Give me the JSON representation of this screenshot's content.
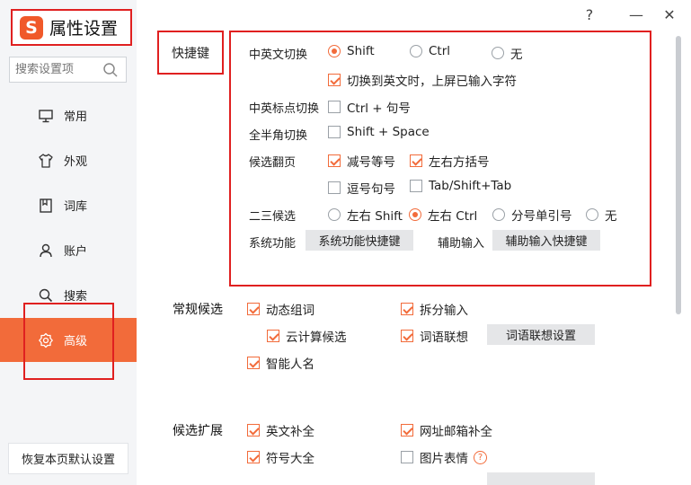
{
  "app": {
    "logo_letter": "S",
    "title": "属性设置"
  },
  "window": {
    "help": "?",
    "minimize": "—",
    "close": "✕"
  },
  "search": {
    "placeholder": "搜索设置项"
  },
  "nav": [
    {
      "label": "常用",
      "icon": "monitor-icon"
    },
    {
      "label": "外观",
      "icon": "shirt-icon"
    },
    {
      "label": "词库",
      "icon": "book-icon"
    },
    {
      "label": "账户",
      "icon": "user-icon"
    },
    {
      "label": "搜索",
      "icon": "search-icon"
    },
    {
      "label": "高级",
      "icon": "gear-icon",
      "active": true
    }
  ],
  "reset_label": "恢复本页默认设置",
  "shortcuts": {
    "section": "快捷键",
    "cn_en": {
      "label": "中英文切换",
      "options": [
        "Shift",
        "Ctrl",
        "无"
      ],
      "selected": "Shift"
    },
    "commit_on_switch": {
      "label": "切换到英文时，上屏已输入字符",
      "checked": true
    },
    "punct": {
      "label": "中英标点切换",
      "option": "Ctrl + 句号",
      "checked": false
    },
    "width": {
      "label": "全半角切换",
      "option": "Shift + Space",
      "checked": false
    },
    "paging": {
      "label": "候选翻页",
      "options": [
        {
          "text": "减号等号",
          "checked": true
        },
        {
          "text": "左右方括号",
          "checked": true
        },
        {
          "text": "逗号句号",
          "checked": false
        },
        {
          "text": "Tab/Shift+Tab",
          "checked": false
        }
      ]
    },
    "second_third": {
      "label": "二三候选",
      "options": [
        "左右 Shift",
        "左右 Ctrl",
        "分号单引号",
        "无"
      ],
      "selected": "左右 Ctrl"
    },
    "system": {
      "label": "系统功能",
      "button": "系统功能快捷键"
    },
    "assist": {
      "label": "辅助输入",
      "button": "辅助输入快捷键"
    }
  },
  "regular": {
    "section": "常规候选",
    "items": [
      {
        "text": "动态组词",
        "checked": true
      },
      {
        "text": "拆分输入",
        "checked": true
      },
      {
        "text": "云计算候选",
        "checked": true
      },
      {
        "text": "词语联想",
        "checked": true
      },
      {
        "text": "智能人名",
        "checked": true
      }
    ],
    "assoc_button": "词语联想设置"
  },
  "expand": {
    "section": "候选扩展",
    "items": [
      {
        "text": "英文补全",
        "checked": true
      },
      {
        "text": "网址邮箱补全",
        "checked": true
      },
      {
        "text": "符号大全",
        "checked": true
      },
      {
        "text": "图片表情",
        "checked": false
      }
    ],
    "help": "?"
  },
  "colors": {
    "accent": "#f26b3a",
    "annotation": "#e02020",
    "sidebar_bg": "#f4f5f7"
  }
}
